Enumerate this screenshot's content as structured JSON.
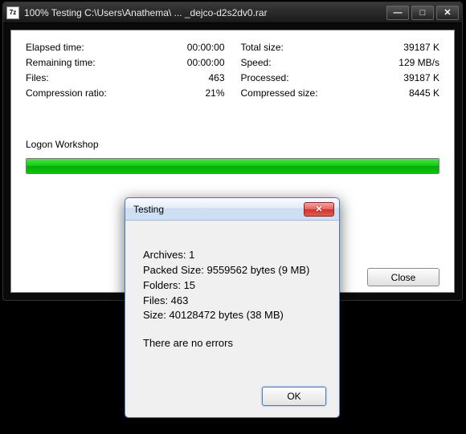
{
  "main": {
    "app_icon_text": "7z",
    "title": "100% Testing C:\\Users\\Anathema\\ ... _dejco-d2s2dv0.rar",
    "stats_left": [
      {
        "label": "Elapsed time:",
        "value": "00:00:00"
      },
      {
        "label": "Remaining time:",
        "value": "00:00:00"
      },
      {
        "label": "Files:",
        "value": "463"
      },
      {
        "label": "Compression ratio:",
        "value": "21%"
      }
    ],
    "stats_right": [
      {
        "label": "Total size:",
        "value": "39187 K"
      },
      {
        "label": "Speed:",
        "value": "129 MB/s"
      },
      {
        "label": "Processed:",
        "value": "39187 K"
      },
      {
        "label": "Compressed size:",
        "value": "8445 K"
      }
    ],
    "current_file": "Logon Workshop",
    "progress_percent": 100,
    "close_label": "Close"
  },
  "dialog": {
    "title": "Testing",
    "lines": {
      "archives": "Archives: 1",
      "packed": "Packed Size: 9559562 bytes (9 MB)",
      "folders": "Folders: 15",
      "files": "Files: 463",
      "size": "Size: 40128472 bytes (38 MB)",
      "status": "There are no errors"
    },
    "ok_label": "OK"
  }
}
